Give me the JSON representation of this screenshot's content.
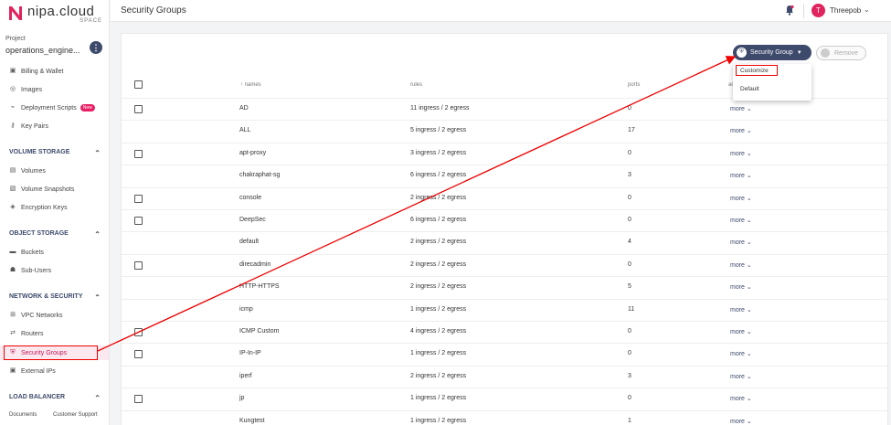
{
  "brand": {
    "name": "nipa.cloud",
    "sub": "SPACE"
  },
  "project": {
    "label": "Project",
    "name": "operations_engine...",
    "info_icon": "info-icon"
  },
  "sidebar": {
    "items_top": [
      {
        "label": "Billing & Wallet",
        "icon": "wallet-icon"
      },
      {
        "label": "Images",
        "icon": "image-icon"
      },
      {
        "label": "Deployment Scripts",
        "icon": "script-icon",
        "badge": "New"
      },
      {
        "label": "Key Pairs",
        "icon": "key-icon"
      }
    ],
    "volume_storage": {
      "title": "VOLUME STORAGE",
      "items": [
        {
          "label": "Volumes",
          "icon": "volume-icon"
        },
        {
          "label": "Volume Snapshots",
          "icon": "snapshot-icon"
        },
        {
          "label": "Encryption Keys",
          "icon": "encryption-icon"
        }
      ]
    },
    "object_storage": {
      "title": "OBJECT STORAGE",
      "items": [
        {
          "label": "Buckets",
          "icon": "bucket-icon"
        },
        {
          "label": "Sub-Users",
          "icon": "users-icon"
        }
      ]
    },
    "network_security": {
      "title": "NETWORK & SECURITY",
      "items": [
        {
          "label": "VPC Networks",
          "icon": "network-icon"
        },
        {
          "label": "Routers",
          "icon": "router-icon"
        },
        {
          "label": "Security Groups",
          "icon": "security-icon"
        },
        {
          "label": "External IPs",
          "icon": "ip-icon"
        }
      ]
    },
    "load_balancer": {
      "title": "LOAD BALANCER"
    },
    "footer": {
      "documents": "Documents",
      "support": "Customer Support"
    }
  },
  "topbar": {
    "title": "Security Groups",
    "user": {
      "initial": "T",
      "name": "Threepob"
    }
  },
  "toolbar": {
    "sg_button": "Security Group",
    "remove_button": "Remove"
  },
  "dropdown": {
    "items": [
      "Customize",
      "Default"
    ]
  },
  "table": {
    "headers": {
      "names": "names",
      "rules": "rules",
      "ports": "ports",
      "actions": "ac"
    },
    "more_label": "more",
    "rows": [
      {
        "name": "AD",
        "rules": "11 ingress / 2 egress",
        "ports": "0",
        "checkbox": true
      },
      {
        "name": "ALL",
        "rules": "5 ingress / 2 egress",
        "ports": "17",
        "checkbox": false
      },
      {
        "name": "apt-proxy",
        "rules": "3 ingress / 2 egress",
        "ports": "0",
        "checkbox": true
      },
      {
        "name": "chakraphat-sg",
        "rules": "6 ingress / 2 egress",
        "ports": "3",
        "checkbox": false
      },
      {
        "name": "console",
        "rules": "2 ingress / 2 egress",
        "ports": "0",
        "checkbox": true
      },
      {
        "name": "DeepSec",
        "rules": "6 ingress / 2 egress",
        "ports": "0",
        "checkbox": true
      },
      {
        "name": "default",
        "rules": "2 ingress / 2 egress",
        "ports": "4",
        "checkbox": false
      },
      {
        "name": "direcadmin",
        "rules": "2 ingress / 2 egress",
        "ports": "0",
        "checkbox": true
      },
      {
        "name": "HTTP-HTTPS",
        "rules": "2 ingress / 2 egress",
        "ports": "5",
        "checkbox": false
      },
      {
        "name": "icmp",
        "rules": "1 ingress / 2 egress",
        "ports": "11",
        "checkbox": false
      },
      {
        "name": "ICMP Custom",
        "rules": "4 ingress / 2 egress",
        "ports": "0",
        "checkbox": true
      },
      {
        "name": "IP-In-IP",
        "rules": "1 ingress / 2 egress",
        "ports": "0",
        "checkbox": true
      },
      {
        "name": "iperf",
        "rules": "2 ingress / 2 egress",
        "ports": "3",
        "checkbox": false
      },
      {
        "name": "jp",
        "rules": "1 ingress / 2 egress",
        "ports": "0",
        "checkbox": true
      },
      {
        "name": "Kungtest",
        "rules": "1 ingress / 2 egress",
        "ports": "1",
        "checkbox": false
      }
    ]
  },
  "annotation_color": "#e00000",
  "brand_color": "#e0245e",
  "accent_color": "#3d4a6b"
}
